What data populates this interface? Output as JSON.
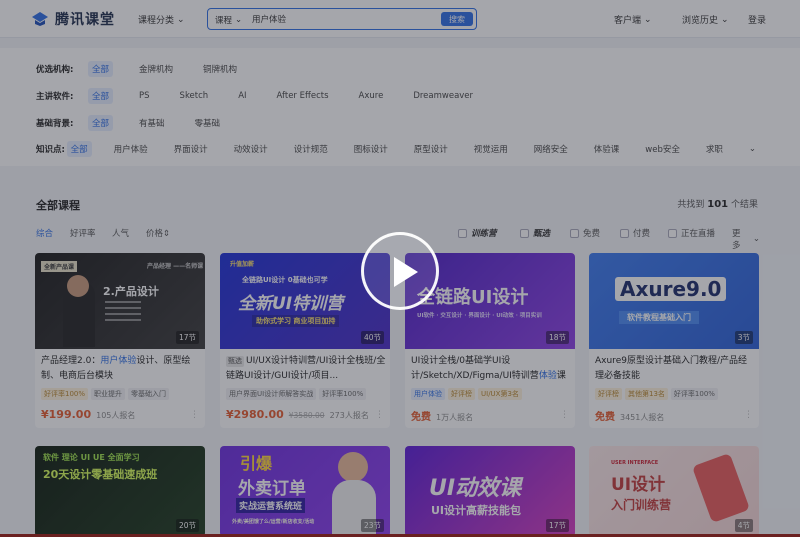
{
  "header": {
    "logo_text": "腾讯课堂",
    "category_label": "课程分类",
    "search_type": "课程",
    "search_value": "用户体验",
    "search_button": "搜索",
    "client": "客户端",
    "history": "浏览历史",
    "login": "登录"
  },
  "filters": [
    {
      "label": "优选机构:",
      "options": [
        "全部",
        "金牌机构",
        "铜牌机构"
      ]
    },
    {
      "label": "主讲软件:",
      "options": [
        "全部",
        "PS",
        "Sketch",
        "AI",
        "After Effects",
        "Axure",
        "Dreamweaver"
      ]
    },
    {
      "label": "基础背景:",
      "options": [
        "全部",
        "有基础",
        "零基础"
      ]
    },
    {
      "label": "知识点:",
      "options": [
        "全部",
        "用户体验",
        "界面设计",
        "动效设计",
        "设计规范",
        "图标设计",
        "原型设计",
        "视觉运用",
        "网络安全",
        "体验课",
        "web安全",
        "求职"
      ]
    }
  ],
  "results": {
    "title": "全部课程",
    "found_prefix": "共找到",
    "found_count": "101",
    "found_suffix": "个结果"
  },
  "sort": {
    "comprehensive": "综合",
    "rating": "好评率",
    "popularity": "人气",
    "price": "价格",
    "training": "训练营",
    "selected": "甄选",
    "free": "免费",
    "paid": "付费",
    "live": "正在直播",
    "more": "更多"
  },
  "cards": [
    {
      "art_main": "2.产品设计",
      "art_sub": "产品经理 ——名师课",
      "art_tag": "全新产品课",
      "lessons": "17节",
      "title_a": "产品经理2.0：",
      "title_hl": "用户体验",
      "title_b": "设计、原型绘制、电商后台模块",
      "tags": [
        "好评率100%",
        "职业提升",
        "零基础入门"
      ],
      "price": "¥199.00",
      "signup": "105人报名"
    },
    {
      "art_main": "全新UI特训营",
      "art_sub": "全链路UI设计  0基础也可学",
      "art_tag": "助你式学习  商业项目加持",
      "art_top": "升值加薪",
      "lessons": "40节",
      "badge": "甄选",
      "title_rest": "UI/UX设计特训营/UI设计全栈班/全链路UI设计/GUI设计/项目...",
      "tags": [
        "用户界面UI设计师解答实战",
        "好评率100%"
      ],
      "price": "¥2980.00",
      "old": "¥3580.00",
      "signup": "273人报名"
    },
    {
      "art_main": "全链路UI设计",
      "art_sub": "UI软件 · 交互设计 · 界面设计 · UI动效 · 项目实训",
      "lessons": "18节",
      "title_a": "UI设计全栈/0基础学UI设计/Sketch/XD/Figma/UI特训营",
      "title_hl": "体验",
      "title_b": "课",
      "tags": [
        "用户体验",
        "好评榜",
        "UI/UX第3名"
      ],
      "price": "免费",
      "signup": "1万人报名"
    },
    {
      "art_main": "Axure9.0",
      "art_sub": "软件教程基础入门",
      "lessons": "3节",
      "title_a": "Axure9原型设计基础入门教程/产品经理必备技能",
      "tags": [
        "好评榜",
        "其他第13名",
        "好评率100%"
      ],
      "price": "免费",
      "signup": "3451人报名"
    },
    {
      "art_main": "20天设计零基础速成班",
      "art_sub": "软件 理论 UI UE 全面学习",
      "lessons": "20节"
    },
    {
      "art_main": "外卖订单",
      "art_sub": "实战运营系统班",
      "art_top": "引爆",
      "art_tag": "外卖/美团饿了么/运营/新店收支/活动",
      "lessons": "23节"
    },
    {
      "art_main": "UI动效课",
      "art_sub": "UI设计高薪技能包",
      "lessons": "17节"
    },
    {
      "art_main": "UI设计",
      "art_sub": "入门训练营",
      "art_top": "USER INTERFACE",
      "lessons": "4节"
    }
  ]
}
